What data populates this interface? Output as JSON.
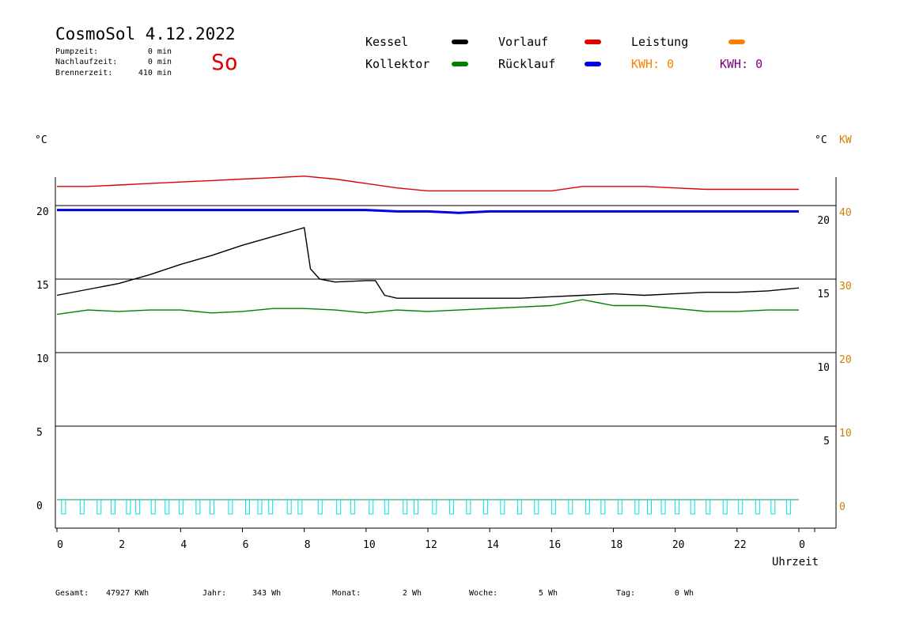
{
  "header": {
    "title": "CosmoSol 4.12.2022",
    "day": "So",
    "pumpzeit_label": "Pumpzeit:",
    "pumpzeit_value": "0 min",
    "nachlauf_label": "Nachlaufzeit:",
    "nachlauf_value": "0 min",
    "brenner_label": "Brennerzeit:",
    "brenner_value": "410 min"
  },
  "legend": {
    "kessel": "Kessel",
    "kollektor": "Kollektor",
    "vorlauf": "Vorlauf",
    "ruecklauf": "Rücklauf",
    "leistung": "Leistung",
    "kwh_left": "KWH: 0",
    "kwh_right": "KWH: 0"
  },
  "axes": {
    "left_unit": "°C",
    "right_unit": "°C",
    "right_unit2": "KW",
    "xlabel": "Uhrzeit"
  },
  "footer": {
    "gesamt_label": "Gesamt:",
    "gesamt_value": "47927 KWh",
    "jahr_label": "Jahr:",
    "jahr_value": "343 Wh",
    "monat_label": "Monat:",
    "monat_value": "2 Wh",
    "woche_label": "Woche:",
    "woche_value": "5 Wh",
    "tag_label": "Tag:",
    "tag_value": "0 Wh"
  },
  "colors": {
    "kessel": "#000000",
    "kollektor": "#007f00",
    "vorlauf": "#e00000",
    "ruecklauf": "#0000e0",
    "leistung": "#ff8000",
    "kwh_right": "#800080",
    "pump": "#00e0e0",
    "kw_axis": "#d08000"
  },
  "chart_data": {
    "type": "line",
    "xlabel": "Uhrzeit",
    "xlim": [
      0,
      24
    ],
    "x_ticks": [
      0,
      2,
      4,
      6,
      8,
      10,
      12,
      14,
      16,
      18,
      20,
      22,
      24
    ],
    "x_tick_labels": [
      "0",
      "2",
      "4",
      "6",
      "8",
      "10",
      "12",
      "14",
      "16",
      "18",
      "20",
      "22",
      "0"
    ],
    "ylim": [
      -1.5,
      22.5
    ],
    "y_ticks_left": [
      0,
      5,
      10,
      15,
      20
    ],
    "y_ticks_right": [
      5,
      10,
      15,
      20
    ],
    "y_ticks_kw": [
      0,
      10,
      20,
      30,
      40
    ],
    "grid_y": [
      5,
      10,
      15,
      20
    ],
    "series": [
      {
        "name": "Vorlauf",
        "color": "#e00000",
        "x": [
          0,
          1,
          2,
          3,
          4,
          5,
          6,
          7,
          8,
          9,
          10,
          11,
          12,
          13,
          14,
          15,
          16,
          17,
          18,
          19,
          20,
          21,
          22,
          23,
          24
        ],
        "y": [
          21.3,
          21.3,
          21.4,
          21.5,
          21.6,
          21.7,
          21.8,
          21.9,
          22.0,
          21.8,
          21.5,
          21.2,
          21.0,
          21.0,
          21.0,
          21.0,
          21.0,
          21.3,
          21.3,
          21.3,
          21.2,
          21.1,
          21.1,
          21.1,
          21.1
        ]
      },
      {
        "name": "Rücklauf",
        "color": "#0000e0",
        "x": [
          0,
          2,
          4,
          6,
          8,
          10,
          11,
          12,
          13,
          14,
          16,
          18,
          20,
          22,
          24
        ],
        "y": [
          19.7,
          19.7,
          19.7,
          19.7,
          19.7,
          19.7,
          19.6,
          19.6,
          19.5,
          19.6,
          19.6,
          19.6,
          19.6,
          19.6,
          19.6
        ]
      },
      {
        "name": "Kessel",
        "color": "#000000",
        "x": [
          0,
          1,
          2,
          3,
          4,
          5,
          6,
          7,
          8,
          8.2,
          8.5,
          9,
          10,
          10.3,
          10.6,
          11,
          12,
          13,
          14,
          15,
          16,
          17,
          18,
          19,
          20,
          21,
          22,
          23,
          24
        ],
        "y": [
          13.9,
          14.3,
          14.7,
          15.3,
          16.0,
          16.6,
          17.3,
          17.9,
          18.5,
          15.7,
          15.0,
          14.8,
          14.9,
          14.9,
          13.9,
          13.7,
          13.7,
          13.7,
          13.7,
          13.7,
          13.8,
          13.9,
          14.0,
          13.9,
          14.0,
          14.1,
          14.1,
          14.2,
          14.4
        ]
      },
      {
        "name": "Kollektor",
        "color": "#007f00",
        "x": [
          0,
          1,
          2,
          3,
          4,
          5,
          6,
          7,
          8,
          9,
          10,
          11,
          12,
          13,
          14,
          15,
          16,
          17,
          18,
          19,
          20,
          21,
          22,
          23,
          24
        ],
        "y": [
          12.6,
          12.9,
          12.8,
          12.9,
          12.9,
          12.7,
          12.8,
          13.0,
          13.0,
          12.9,
          12.7,
          12.9,
          12.8,
          12.9,
          13.0,
          13.1,
          13.2,
          13.6,
          13.2,
          13.2,
          13.0,
          12.8,
          12.8,
          12.9,
          12.9
        ]
      },
      {
        "name": "Leistung",
        "color": "#ff8000",
        "x": [
          0,
          24
        ],
        "y": [
          0,
          0
        ]
      }
    ],
    "pump_marks_x": [
      0.15,
      0.75,
      1.3,
      1.75,
      2.25,
      2.55,
      3.05,
      3.5,
      3.95,
      4.5,
      4.95,
      5.55,
      6.1,
      6.5,
      6.85,
      7.45,
      7.8,
      8.45,
      9.05,
      9.5,
      10.1,
      10.6,
      11.2,
      11.55,
      12.15,
      12.7,
      13.25,
      13.8,
      14.35,
      14.9,
      15.45,
      16.0,
      16.55,
      17.1,
      17.6,
      18.15,
      18.7,
      19.1,
      19.55,
      20.0,
      20.5,
      21.0,
      21.55,
      22.05,
      22.6,
      23.1,
      23.6
    ]
  }
}
